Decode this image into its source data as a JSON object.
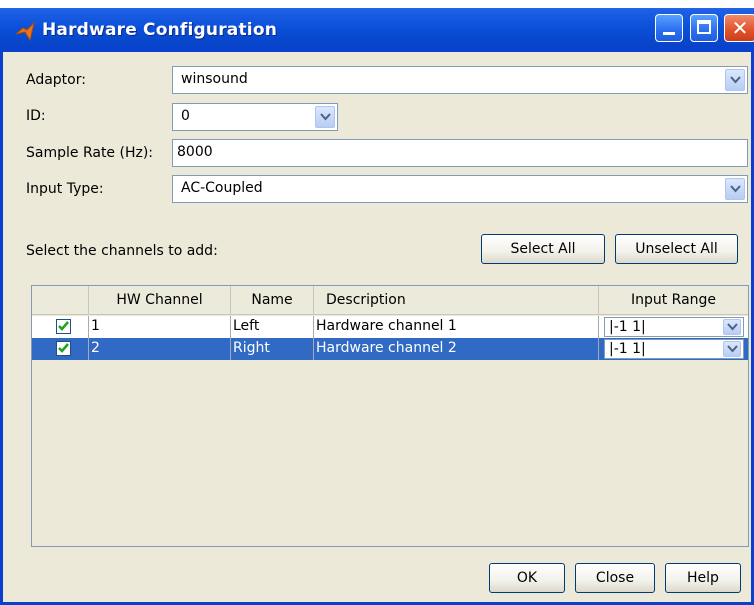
{
  "window": {
    "title": "Hardware Configuration"
  },
  "form": {
    "adaptor_label": "Adaptor:",
    "adaptor_value": "winsound",
    "id_label": "ID:",
    "id_value": "0",
    "sample_rate_label": "Sample Rate (Hz):",
    "sample_rate_value": "8000",
    "input_type_label": "Input Type:",
    "input_type_value": "AC-Coupled"
  },
  "channels": {
    "prompt": "Select the channels to add:",
    "select_all": "Select All",
    "unselect_all": "Unselect All",
    "headers": {
      "hw_channel": "HW Channel",
      "name": "Name",
      "description": "Description",
      "input_range": "Input Range"
    },
    "rows": [
      {
        "checked": true,
        "hw_channel": "1",
        "name": "Left",
        "description": "Hardware channel 1",
        "input_range": "|-1 1|",
        "selected": false
      },
      {
        "checked": true,
        "hw_channel": "2",
        "name": "Right",
        "description": "Hardware channel 2",
        "input_range": "|-1 1|",
        "selected": true
      }
    ]
  },
  "footer": {
    "ok": "OK",
    "close": "Close",
    "help": "Help"
  },
  "colors": {
    "titlebar": "#0a4fd8",
    "selection": "#316ac5",
    "dialog_bg": "#ece9d8"
  }
}
